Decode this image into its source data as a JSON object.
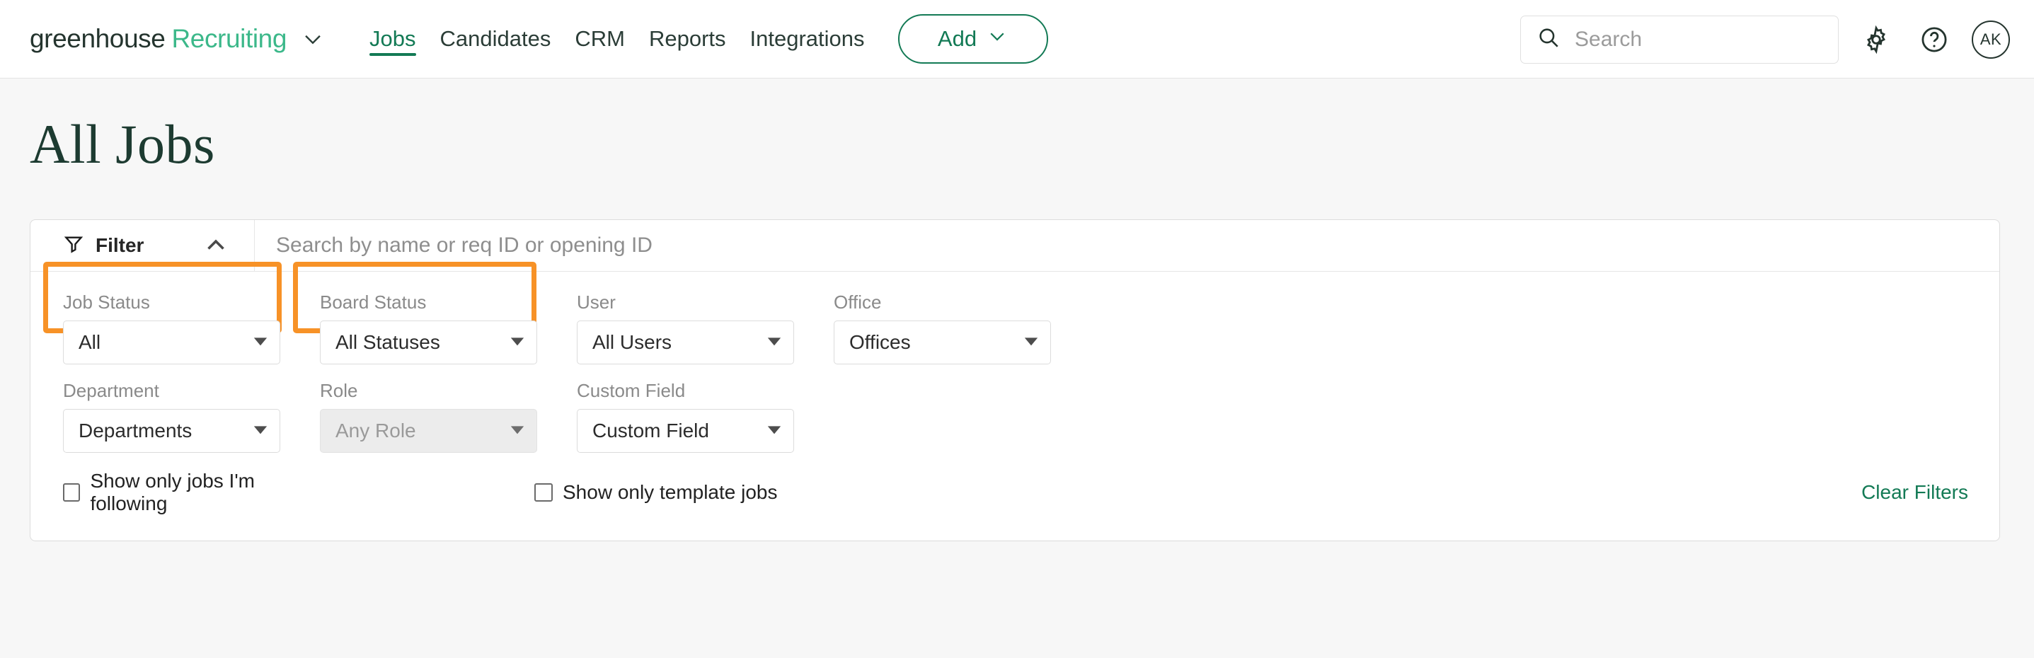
{
  "nav": {
    "brand_primary": "greenhouse",
    "brand_secondary": "Recruiting",
    "links": [
      {
        "label": "Jobs",
        "active": true
      },
      {
        "label": "Candidates",
        "active": false
      },
      {
        "label": "CRM",
        "active": false
      },
      {
        "label": "Reports",
        "active": false
      },
      {
        "label": "Integrations",
        "active": false
      }
    ],
    "add_label": "Add",
    "search_placeholder": "Search",
    "avatar_initials": "AK",
    "icons": {
      "brand_caret": "chevron-down-icon",
      "add_caret": "chevron-down-icon",
      "search": "search-icon",
      "settings": "gear-icon",
      "help": "question-circle-icon"
    }
  },
  "page": {
    "title": "All Jobs"
  },
  "filter": {
    "toggle_label": "Filter",
    "toggle_icon": "funnel-icon",
    "collapse_icon": "chevron-up-icon",
    "search_placeholder": "Search by name or req ID or opening ID",
    "row1": [
      {
        "label": "Job Status",
        "value": "All",
        "disabled": false,
        "highlighted": true
      },
      {
        "label": "Board Status",
        "value": "All Statuses",
        "disabled": false,
        "highlighted": true
      },
      {
        "label": "User",
        "value": "All Users",
        "disabled": false,
        "highlighted": false
      },
      {
        "label": "Office",
        "value": "Offices",
        "disabled": false,
        "highlighted": false
      }
    ],
    "row2": [
      {
        "label": "Department",
        "value": "Departments",
        "disabled": false
      },
      {
        "label": "Role",
        "value": "Any Role",
        "disabled": true
      },
      {
        "label": "Custom Field",
        "value": "Custom Field",
        "disabled": false
      }
    ],
    "checkboxes": [
      {
        "label": "Show only jobs I'm following",
        "checked": false
      },
      {
        "label": "Show only template jobs",
        "checked": false
      }
    ],
    "clear_label": "Clear Filters"
  },
  "colors": {
    "brand_green": "#137a55",
    "brand_light_green": "#3cb88a",
    "title_green": "#1d3b31",
    "highlight_orange": "#f79227",
    "page_bg": "#f7f7f7"
  }
}
